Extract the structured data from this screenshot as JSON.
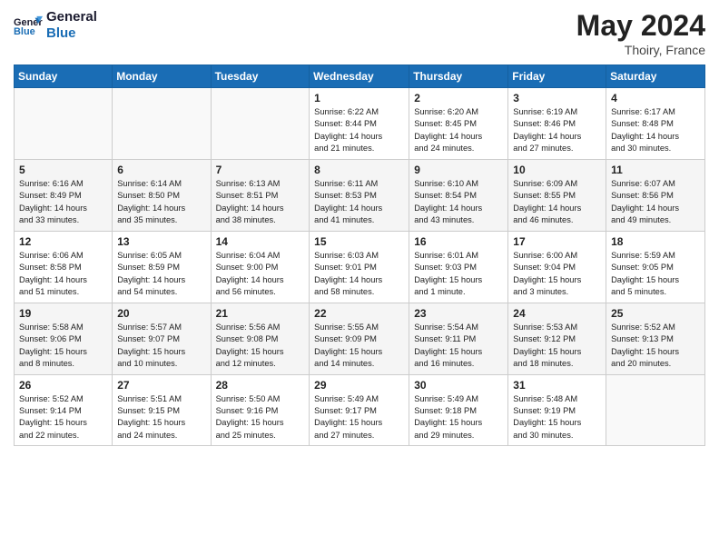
{
  "header": {
    "logo_line1": "General",
    "logo_line2": "Blue",
    "month": "May 2024",
    "location": "Thoiry, France"
  },
  "weekdays": [
    "Sunday",
    "Monday",
    "Tuesday",
    "Wednesday",
    "Thursday",
    "Friday",
    "Saturday"
  ],
  "weeks": [
    [
      {
        "day": "",
        "info": ""
      },
      {
        "day": "",
        "info": ""
      },
      {
        "day": "",
        "info": ""
      },
      {
        "day": "1",
        "info": "Sunrise: 6:22 AM\nSunset: 8:44 PM\nDaylight: 14 hours\nand 21 minutes."
      },
      {
        "day": "2",
        "info": "Sunrise: 6:20 AM\nSunset: 8:45 PM\nDaylight: 14 hours\nand 24 minutes."
      },
      {
        "day": "3",
        "info": "Sunrise: 6:19 AM\nSunset: 8:46 PM\nDaylight: 14 hours\nand 27 minutes."
      },
      {
        "day": "4",
        "info": "Sunrise: 6:17 AM\nSunset: 8:48 PM\nDaylight: 14 hours\nand 30 minutes."
      }
    ],
    [
      {
        "day": "5",
        "info": "Sunrise: 6:16 AM\nSunset: 8:49 PM\nDaylight: 14 hours\nand 33 minutes."
      },
      {
        "day": "6",
        "info": "Sunrise: 6:14 AM\nSunset: 8:50 PM\nDaylight: 14 hours\nand 35 minutes."
      },
      {
        "day": "7",
        "info": "Sunrise: 6:13 AM\nSunset: 8:51 PM\nDaylight: 14 hours\nand 38 minutes."
      },
      {
        "day": "8",
        "info": "Sunrise: 6:11 AM\nSunset: 8:53 PM\nDaylight: 14 hours\nand 41 minutes."
      },
      {
        "day": "9",
        "info": "Sunrise: 6:10 AM\nSunset: 8:54 PM\nDaylight: 14 hours\nand 43 minutes."
      },
      {
        "day": "10",
        "info": "Sunrise: 6:09 AM\nSunset: 8:55 PM\nDaylight: 14 hours\nand 46 minutes."
      },
      {
        "day": "11",
        "info": "Sunrise: 6:07 AM\nSunset: 8:56 PM\nDaylight: 14 hours\nand 49 minutes."
      }
    ],
    [
      {
        "day": "12",
        "info": "Sunrise: 6:06 AM\nSunset: 8:58 PM\nDaylight: 14 hours\nand 51 minutes."
      },
      {
        "day": "13",
        "info": "Sunrise: 6:05 AM\nSunset: 8:59 PM\nDaylight: 14 hours\nand 54 minutes."
      },
      {
        "day": "14",
        "info": "Sunrise: 6:04 AM\nSunset: 9:00 PM\nDaylight: 14 hours\nand 56 minutes."
      },
      {
        "day": "15",
        "info": "Sunrise: 6:03 AM\nSunset: 9:01 PM\nDaylight: 14 hours\nand 58 minutes."
      },
      {
        "day": "16",
        "info": "Sunrise: 6:01 AM\nSunset: 9:03 PM\nDaylight: 15 hours\nand 1 minute."
      },
      {
        "day": "17",
        "info": "Sunrise: 6:00 AM\nSunset: 9:04 PM\nDaylight: 15 hours\nand 3 minutes."
      },
      {
        "day": "18",
        "info": "Sunrise: 5:59 AM\nSunset: 9:05 PM\nDaylight: 15 hours\nand 5 minutes."
      }
    ],
    [
      {
        "day": "19",
        "info": "Sunrise: 5:58 AM\nSunset: 9:06 PM\nDaylight: 15 hours\nand 8 minutes."
      },
      {
        "day": "20",
        "info": "Sunrise: 5:57 AM\nSunset: 9:07 PM\nDaylight: 15 hours\nand 10 minutes."
      },
      {
        "day": "21",
        "info": "Sunrise: 5:56 AM\nSunset: 9:08 PM\nDaylight: 15 hours\nand 12 minutes."
      },
      {
        "day": "22",
        "info": "Sunrise: 5:55 AM\nSunset: 9:09 PM\nDaylight: 15 hours\nand 14 minutes."
      },
      {
        "day": "23",
        "info": "Sunrise: 5:54 AM\nSunset: 9:11 PM\nDaylight: 15 hours\nand 16 minutes."
      },
      {
        "day": "24",
        "info": "Sunrise: 5:53 AM\nSunset: 9:12 PM\nDaylight: 15 hours\nand 18 minutes."
      },
      {
        "day": "25",
        "info": "Sunrise: 5:52 AM\nSunset: 9:13 PM\nDaylight: 15 hours\nand 20 minutes."
      }
    ],
    [
      {
        "day": "26",
        "info": "Sunrise: 5:52 AM\nSunset: 9:14 PM\nDaylight: 15 hours\nand 22 minutes."
      },
      {
        "day": "27",
        "info": "Sunrise: 5:51 AM\nSunset: 9:15 PM\nDaylight: 15 hours\nand 24 minutes."
      },
      {
        "day": "28",
        "info": "Sunrise: 5:50 AM\nSunset: 9:16 PM\nDaylight: 15 hours\nand 25 minutes."
      },
      {
        "day": "29",
        "info": "Sunrise: 5:49 AM\nSunset: 9:17 PM\nDaylight: 15 hours\nand 27 minutes."
      },
      {
        "day": "30",
        "info": "Sunrise: 5:49 AM\nSunset: 9:18 PM\nDaylight: 15 hours\nand 29 minutes."
      },
      {
        "day": "31",
        "info": "Sunrise: 5:48 AM\nSunset: 9:19 PM\nDaylight: 15 hours\nand 30 minutes."
      },
      {
        "day": "",
        "info": ""
      }
    ]
  ]
}
